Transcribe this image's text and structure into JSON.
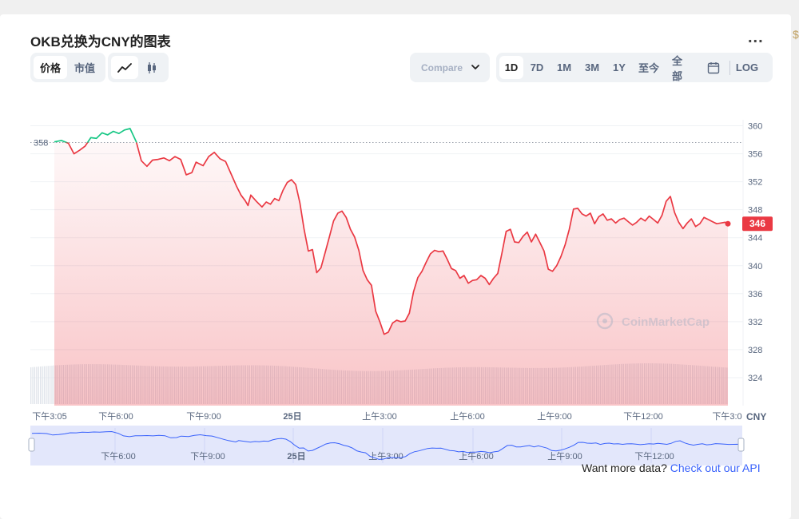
{
  "header": {
    "title": "OKB兑换为CNY的图表",
    "more_label": "..."
  },
  "toolbar": {
    "type_tabs": [
      {
        "label": "价格",
        "active": true
      },
      {
        "label": "市值",
        "active": false
      }
    ],
    "view_icons": [
      "line-chart-icon",
      "candlestick-icon"
    ],
    "compare_label": "Compare",
    "range_tabs": [
      {
        "label": "1D",
        "active": true
      },
      {
        "label": "7D",
        "active": false
      },
      {
        "label": "1M",
        "active": false
      },
      {
        "label": "3M",
        "active": false
      },
      {
        "label": "1Y",
        "active": false
      },
      {
        "label": "至今",
        "active": false
      },
      {
        "label": "全部",
        "active": false
      }
    ],
    "calendar_icon": "calendar-icon",
    "log_label": "LOG"
  },
  "watermark": "CoinMarketCap",
  "footer": {
    "text": "Want more data?",
    "link": "Check out our API"
  },
  "colors": {
    "up": "#16c784",
    "down": "#ea3943",
    "accent": "#3861fb"
  },
  "chart_data": {
    "type": "line",
    "currency_label": "CNY",
    "open_price_label": "358",
    "open_price": 357.6,
    "current_price": 346,
    "ylim": [
      320,
      362
    ],
    "y_ticks": [
      "360",
      "356",
      "352",
      "348",
      "344",
      "340",
      "336",
      "332",
      "328",
      "324"
    ],
    "x_labels": [
      "下午3:05",
      "下午6:00",
      "下午9:00",
      "25日",
      "上午3:00",
      "上午6:00",
      "上午9:00",
      "下午12:00",
      "下午3:0"
    ],
    "navigator_labels": [
      "下午6:00",
      "下午9:00",
      "25日",
      "上午3:00",
      "上午6:00",
      "上午9:00",
      "下午12:00"
    ],
    "x_hours": [
      0,
      0.25,
      0.5,
      0.7,
      0.9,
      1.1,
      1.3,
      1.5,
      1.7,
      1.9,
      2.1,
      2.3,
      2.5,
      2.7,
      2.92,
      3.1,
      3.3,
      3.5,
      3.7,
      3.9,
      4.1,
      4.3,
      4.5,
      4.7,
      4.9,
      5.05,
      5.3,
      5.5,
      5.7,
      5.9,
      6.1,
      6.3,
      6.5,
      6.65,
      6.8,
      6.9,
      7.0,
      7.2,
      7.4,
      7.55,
      7.7,
      7.85,
      8.0,
      8.15,
      8.3,
      8.45,
      8.6,
      8.75,
      8.9,
      9.05,
      9.2,
      9.35,
      9.5,
      9.65,
      9.8,
      9.95,
      10.1,
      10.25,
      10.4,
      10.55,
      10.7,
      10.85,
      11.0,
      11.15,
      11.3,
      11.45,
      11.6,
      11.75,
      11.9,
      12.05,
      12.2,
      12.35,
      12.5,
      12.65,
      12.8,
      12.95,
      13.1,
      13.25,
      13.4,
      13.55,
      13.7,
      13.85,
      14.0,
      14.15,
      14.3,
      14.45,
      14.6,
      14.75,
      14.9,
      15.05,
      15.2,
      15.35,
      15.5,
      15.65,
      15.8,
      15.95,
      16.1,
      16.25,
      16.4,
      16.55,
      16.7,
      16.85,
      17.0,
      17.15,
      17.3,
      17.45,
      17.6,
      17.75,
      17.9,
      18.05,
      18.2,
      18.35,
      18.5,
      18.65,
      18.8,
      18.95,
      19.1,
      19.25,
      19.4,
      19.55,
      19.7,
      19.85,
      20.0,
      20.15,
      20.3,
      20.45,
      20.6,
      20.75,
      20.9,
      21.05,
      21.2,
      21.35,
      21.5,
      21.65,
      21.8,
      21.95,
      22.1,
      22.25,
      22.4,
      22.55,
      22.7,
      22.85,
      23.0,
      23.15,
      23.3,
      23.45,
      23.6,
      23.75,
      23.9,
      24.0
    ],
    "series": [
      {
        "values": [
          357.7,
          357.9,
          357.5,
          356.0,
          356.5,
          357.1,
          358.3,
          358.2,
          359.0,
          358.7,
          359.2,
          358.9,
          359.4,
          359.6,
          357.7,
          355.0,
          354.2,
          355.1,
          355.2,
          355.4,
          355.0,
          355.6,
          355.2,
          353.0,
          353.3,
          354.8,
          354.3,
          355.6,
          356.2,
          355.3,
          354.9,
          353.1,
          351.3,
          350.1,
          349.3,
          348.6,
          350.1,
          349.2,
          348.4,
          349.1,
          348.8,
          349.6,
          349.3,
          350.8,
          351.9,
          352.3,
          351.6,
          349.0,
          345.2,
          342.1,
          342.3,
          339.0,
          339.7,
          341.9,
          344.1,
          346.4,
          347.5,
          347.8,
          346.9,
          345.2,
          344.1,
          342.2,
          339.3,
          338.0,
          337.2,
          333.5,
          332.0,
          330.2,
          330.5,
          331.8,
          332.2,
          332.0,
          332.1,
          333.2,
          336.3,
          338.3,
          339.2,
          340.5,
          341.7,
          342.2,
          342.0,
          342.1,
          340.9,
          339.6,
          339.3,
          338.2,
          338.6,
          337.5,
          337.9,
          338.0,
          338.6,
          338.2,
          337.3,
          338.2,
          338.9,
          341.8,
          344.9,
          345.2,
          343.4,
          343.3,
          344.2,
          344.8,
          343.4,
          344.5,
          343.3,
          342.1,
          339.5,
          339.2,
          340.0,
          341.3,
          343.0,
          345.2,
          348.1,
          348.2,
          347.4,
          347.1,
          347.5,
          346.0,
          347.0,
          347.4,
          346.5,
          346.7,
          346.1,
          346.6,
          346.8,
          346.3,
          345.8,
          346.2,
          346.8,
          346.4,
          347.1,
          346.6,
          346.1,
          347.2,
          349.2,
          349.9,
          347.6,
          346.2,
          345.3,
          346.1,
          346.7,
          345.6,
          346.0,
          346.9,
          346.6,
          346.3,
          346.0,
          346.1,
          346.2,
          346.0
        ]
      }
    ],
    "grid": true,
    "legend": "none"
  }
}
